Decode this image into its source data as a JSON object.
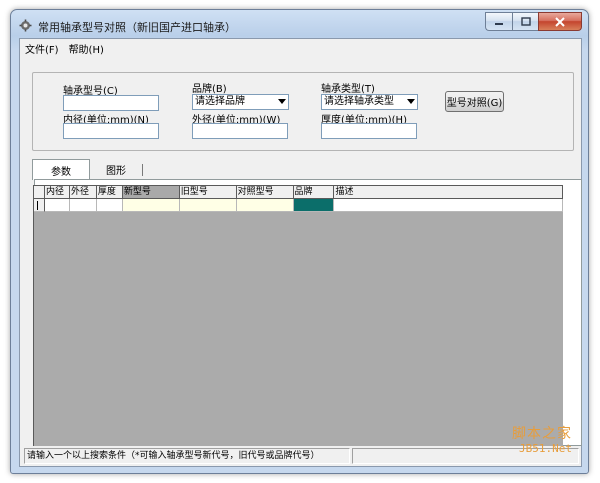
{
  "window": {
    "title": "常用轴承型号对照（新旧国产进口轴承）"
  },
  "menu": [
    {
      "label": "文件(F)"
    },
    {
      "label": "帮助(H)"
    }
  ],
  "search": {
    "bearing_model_label": "轴承型号(C)",
    "brand_label": "品牌(B)",
    "brand_value": "请选择品牌",
    "bearing_type_label": "轴承类型(T)",
    "bearing_type_value": "请选择轴承类型",
    "compare_button": "型号对照(G)",
    "inner_diameter_label": "内径(单位:mm)(N)",
    "outer_diameter_label": "外径(单位:mm)(W)",
    "thickness_label": "厚度(单位:mm)(H)"
  },
  "tabs": [
    {
      "label": "参数"
    },
    {
      "label": "图形"
    }
  ],
  "grid": {
    "columns": [
      {
        "label": "内径"
      },
      {
        "label": "外径"
      },
      {
        "label": "厚度"
      },
      {
        "label": "新型号"
      },
      {
        "label": "旧型号"
      },
      {
        "label": "对照型号"
      },
      {
        "label": "品牌"
      },
      {
        "label": "描述"
      }
    ],
    "sorted_column": "新型号",
    "selected_cell_color": "#0b6e6a"
  },
  "status": {
    "message": "请输入一个以上搜索条件（*可输入轴承型号新代号，旧代号或品牌代号）"
  },
  "watermark": {
    "text": "脚本之家",
    "url": "JB51.Net"
  },
  "colors": {
    "title_gradient": "#b9cfe9",
    "close_button": "#c4442e",
    "accent_teal": "#0b6e6a"
  }
}
